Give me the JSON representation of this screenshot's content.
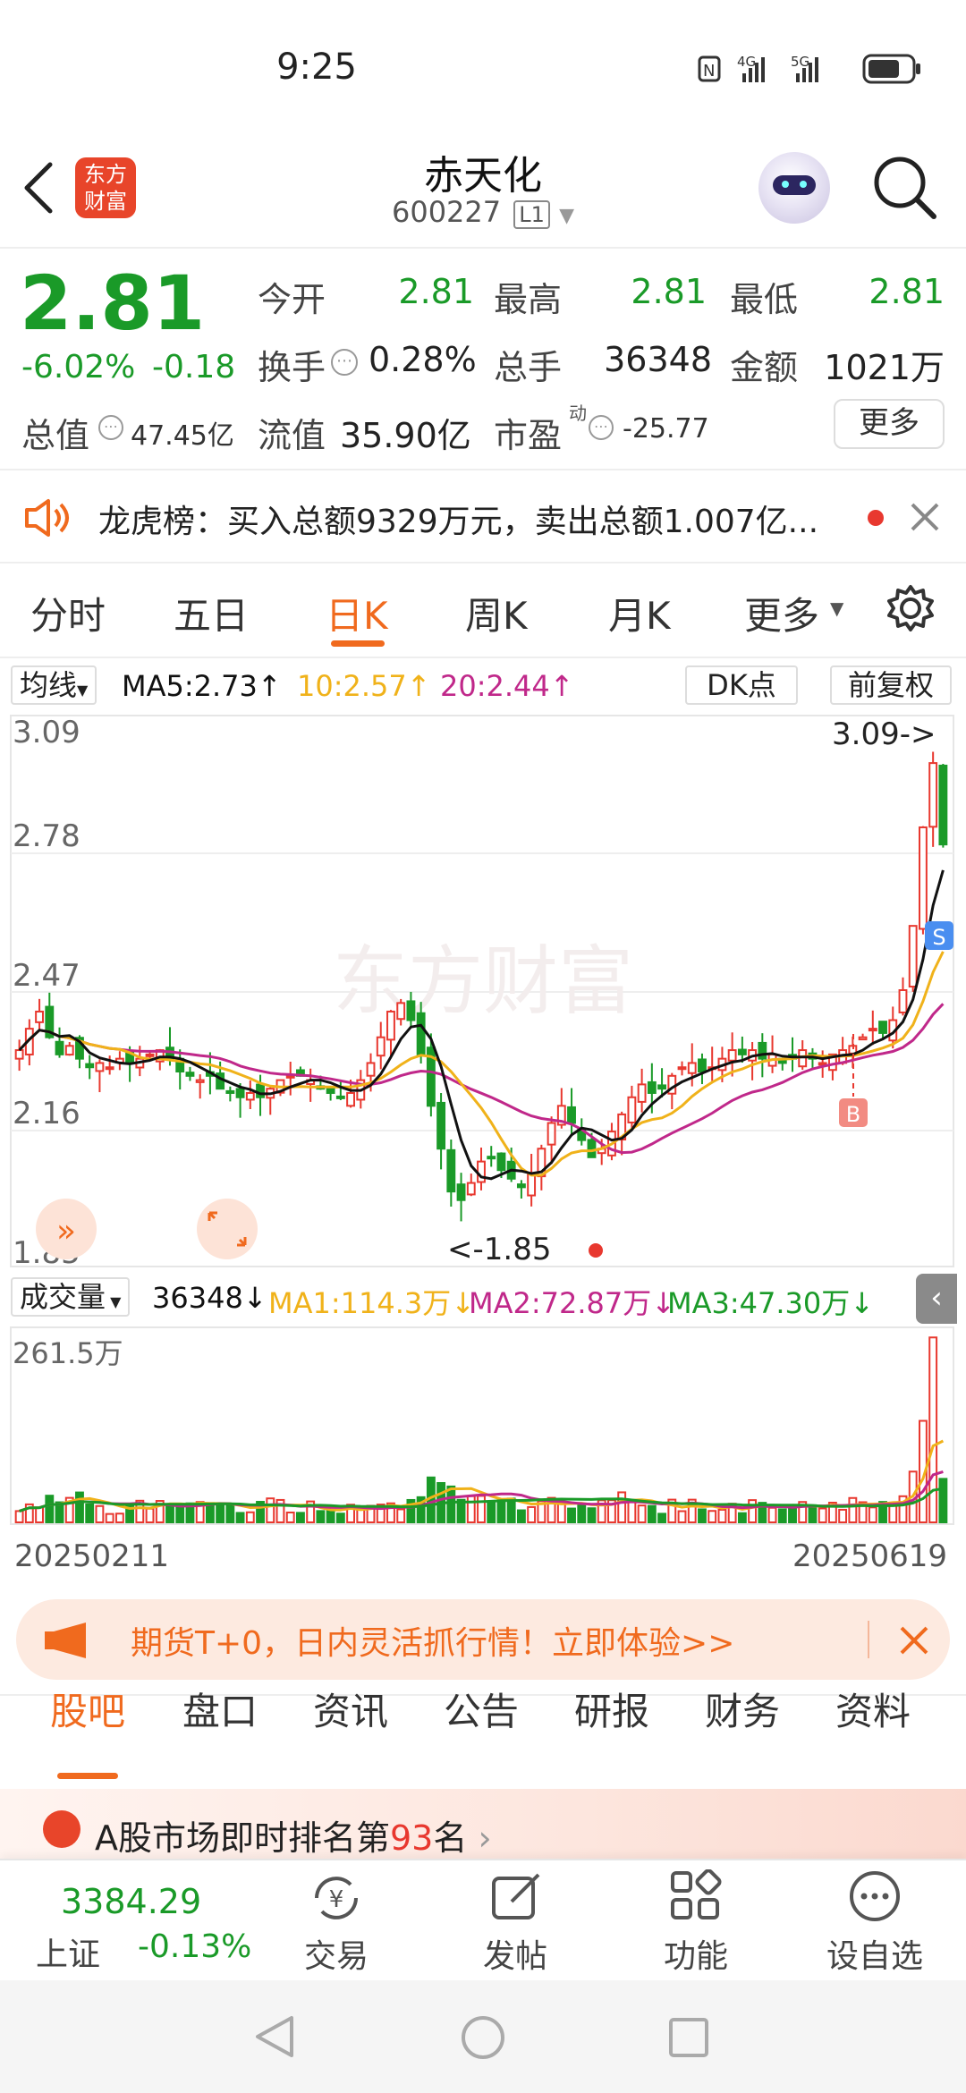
{
  "status": {
    "time": "9:25",
    "net1": "4G",
    "net2": "5G"
  },
  "header": {
    "title": "赤天化",
    "code": "600227",
    "level": "L1",
    "logo_line1": "东方",
    "logo_line2": "财富"
  },
  "quote": {
    "price": "2.81",
    "change_pct": "-6.02%",
    "change": "-0.18",
    "open_label": "今开",
    "open": "2.81",
    "high_label": "最高",
    "high": "2.81",
    "low_label": "最低",
    "low": "2.81",
    "turnover_label": "换手",
    "turnover": "0.28%",
    "volume_label": "总手",
    "volume": "36348",
    "amount_label": "金额",
    "amount": "1021万",
    "mcap_label": "总值",
    "mcap": "47.45亿",
    "float_label": "流值",
    "float_cap": "35.90亿",
    "pe_label": "市盈",
    "pe_sup": "动",
    "pe": "-25.77",
    "more": "更多"
  },
  "notice": {
    "text": "龙虎榜：买入总额9329万元，卖出总额1.007亿..."
  },
  "chart_tabs": [
    "分时",
    "五日",
    "日K",
    "周K",
    "月K",
    "更多"
  ],
  "ma": {
    "label": "均线",
    "ma5": "MA5:2.73↑",
    "ma10": "10:2.57↑",
    "ma20": "20:2.44↑",
    "dk": "DK点",
    "adjust": "前复权"
  },
  "vol": {
    "label": "成交量",
    "value": "36348↓",
    "ma1": "MA1:114.3万↓",
    "ma2": "MA2:72.87万↓",
    "ma3": "MA3:47.30万↓",
    "max": "261.5万"
  },
  "colors": {
    "up": "#e8382f",
    "down": "#1a9a28",
    "ma5": "#111111",
    "ma10": "#f0b21a",
    "ma20": "#c0288a",
    "accent": "#f06a1e"
  },
  "chart_data": {
    "type": "candlestick",
    "y_ticks": [
      "3.09",
      "2.78",
      "2.47",
      "2.16",
      "1.85"
    ],
    "ylim": [
      1.85,
      3.09
    ],
    "max_label": "3.09->",
    "min_label": "<-1.85",
    "date_start": "20250211",
    "date_end": "20250619",
    "close": [
      2.33,
      2.38,
      2.42,
      2.36,
      2.32,
      2.34,
      2.31,
      2.29,
      2.3,
      2.29,
      2.31,
      2.3,
      2.31,
      2.32,
      2.33,
      2.31,
      2.28,
      2.27,
      2.26,
      2.27,
      2.24,
      2.23,
      2.22,
      2.23,
      2.22,
      2.24,
      2.26,
      2.27,
      2.27,
      2.26,
      2.24,
      2.23,
      2.22,
      2.23,
      2.26,
      2.3,
      2.36,
      2.42,
      2.44,
      2.4,
      2.32,
      2.2,
      2.1,
      2.0,
      1.98,
      2.02,
      2.07,
      2.08,
      2.05,
      2.03,
      2.01,
      2.04,
      2.1,
      2.16,
      2.2,
      2.16,
      2.12,
      2.08,
      2.1,
      2.14,
      2.18,
      2.22,
      2.25,
      2.23,
      2.24,
      2.27,
      2.29,
      2.3,
      2.28,
      2.29,
      2.31,
      2.33,
      2.32,
      2.33,
      2.31,
      2.32,
      2.3,
      2.31,
      2.33,
      2.31,
      2.3,
      2.32,
      2.33,
      2.34,
      2.36,
      2.38,
      2.37,
      2.4,
      2.47,
      2.62,
      2.85,
      3.0,
      2.81
    ],
    "volume_labels": {
      "max": "261.5万"
    }
  },
  "promo": {
    "text": "期货T+0，日内灵活抓行情！立即体验>>"
  },
  "bottom_tabs": [
    "股吧",
    "盘口",
    "资讯",
    "公告",
    "研报",
    "财务",
    "资料"
  ],
  "rank": {
    "prefix": "A股市场即时排名第",
    "num": "93",
    "suffix": "名"
  },
  "bottom_nav": {
    "index_value": "3384.29",
    "index_name": "上证",
    "index_change": "-0.13%",
    "trade": "交易",
    "post": "发帖",
    "func": "功能",
    "watch": "设自选"
  },
  "watermark": "东方财富"
}
